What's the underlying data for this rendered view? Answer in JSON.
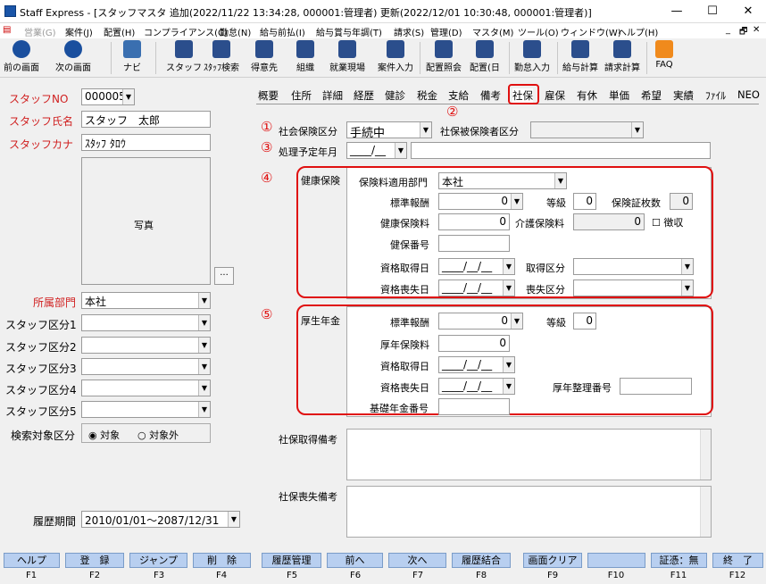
{
  "title": "Staff Express - [スタッフマスタ 追加(2022/11/22 13:34:28, 000001:管理者) 更新(2022/12/01 10:30:48, 000001:管理者)]",
  "window": {
    "minimize": "—",
    "maximize": "☐",
    "close": "✕"
  },
  "menu": [
    "営業(G)",
    "案件(J)",
    "配置(H)",
    "コンプライアンス(C)",
    "勤怠(N)",
    "給与前払(I)",
    "給与賞与年調(T)",
    "請求(S)",
    "管理(D)",
    "マスタ(M)",
    "ツール(O)",
    "ウィンドウ(W)",
    "ヘルプ(H)"
  ],
  "menu_right": [
    "_",
    "🗗",
    "✕"
  ],
  "toolbar": [
    "前の画面",
    "次の画面",
    "ナビ",
    "スタッフ",
    "ｽﾀｯﾌ検索",
    "得意先",
    "組織",
    "就業現場",
    "案件入力",
    "配置照会",
    "配置(日",
    "勤怠入力",
    "給与計算",
    "請求計算",
    "FAQ"
  ],
  "left": {
    "staff_no_label": "スタッフNO",
    "staff_no": "000005",
    "name_label": "スタッフ氏名",
    "name": "スタッフ　太郎",
    "kana_label": "スタッフカナ",
    "kana": "ｽﾀｯﾌ ﾀﾛｳ",
    "photo_label": "写真",
    "photo_btn": "...",
    "dept_label": "所属部門",
    "dept": "本社",
    "kubun_labels": [
      "スタッフ区分1",
      "スタッフ区分2",
      "スタッフ区分3",
      "スタッフ区分4",
      "スタッフ区分5"
    ],
    "search_label": "検索対象区分",
    "radio_on": "対象",
    "radio_off": "対象外",
    "period_label": "履歴期間",
    "period": "2010/01/01～2087/12/31"
  },
  "tabs": [
    "概要",
    "住所",
    "詳細",
    "経歴",
    "健診",
    "税金",
    "支給",
    "備考",
    "社保",
    "雇保",
    "有休",
    "単価",
    "希望",
    "実績",
    "ﾌｧｲﾙ",
    "NEO"
  ],
  "form": {
    "c1": "①",
    "c2": "②",
    "c3": "③",
    "c4": "④",
    "c5": "⑤",
    "shaho_kubun_label": "社会保険区分",
    "shaho_kubun": "手続中",
    "hihoken_label": "社保被保険者区分",
    "yotei_label": "処理予定年月",
    "yotei": "____/__",
    "kenko": {
      "title": "健康保険",
      "dept_label": "保険料適用部門",
      "dept": "本社",
      "hyojun_label": "標準報酬",
      "hyojun": "0",
      "tokyu_label": "等級",
      "tokyu": "0",
      "maisu_label": "保険証枚数",
      "maisu": "0",
      "hokenryo_label": "健康保険料",
      "hokenryo": "0",
      "kaigo_label": "介護保険料",
      "kaigo": "0",
      "choshu_label": "徴収",
      "bango_label": "健保番号",
      "shutoku_label": "資格取得日",
      "shutoku": "____/__/__",
      "shutoku_kubun_label": "取得区分",
      "soshitsu_label": "資格喪失日",
      "soshitsu": "____/__/__",
      "soshitsu_kubun_label": "喪失区分"
    },
    "kosei": {
      "title": "厚生年金",
      "hyojun_label": "標準報酬",
      "hyojun": "0",
      "tokyu_label": "等級",
      "tokyu": "0",
      "hokenryo_label": "厚年保険料",
      "hokenryo": "0",
      "shutoku_label": "資格取得日",
      "shutoku": "____/__/__",
      "soshitsu_label": "資格喪失日",
      "soshitsu": "____/__/__",
      "seiri_label": "厚年整理番号",
      "kiso_label": "基礎年金番号"
    },
    "shutoku_biko_label": "社保取得備考",
    "soshitsu_biko_label": "社保喪失備考"
  },
  "fkeys": [
    {
      "label": "ヘルプ",
      "key": "F1"
    },
    {
      "label": "登　録",
      "key": "F2"
    },
    {
      "label": "ジャンプ",
      "key": "F3"
    },
    {
      "label": "削　除",
      "key": "F4"
    },
    {
      "label": "履歴管理",
      "key": "F5"
    },
    {
      "label": "前へ",
      "key": "F6"
    },
    {
      "label": "次へ",
      "key": "F7"
    },
    {
      "label": "履歴結合",
      "key": "F8"
    },
    {
      "label": "画面クリア",
      "key": "F9"
    },
    {
      "label": "",
      "key": "F10"
    },
    {
      "label": "証憑：無",
      "key": "F11"
    },
    {
      "label": "終　了",
      "key": "F12"
    }
  ]
}
